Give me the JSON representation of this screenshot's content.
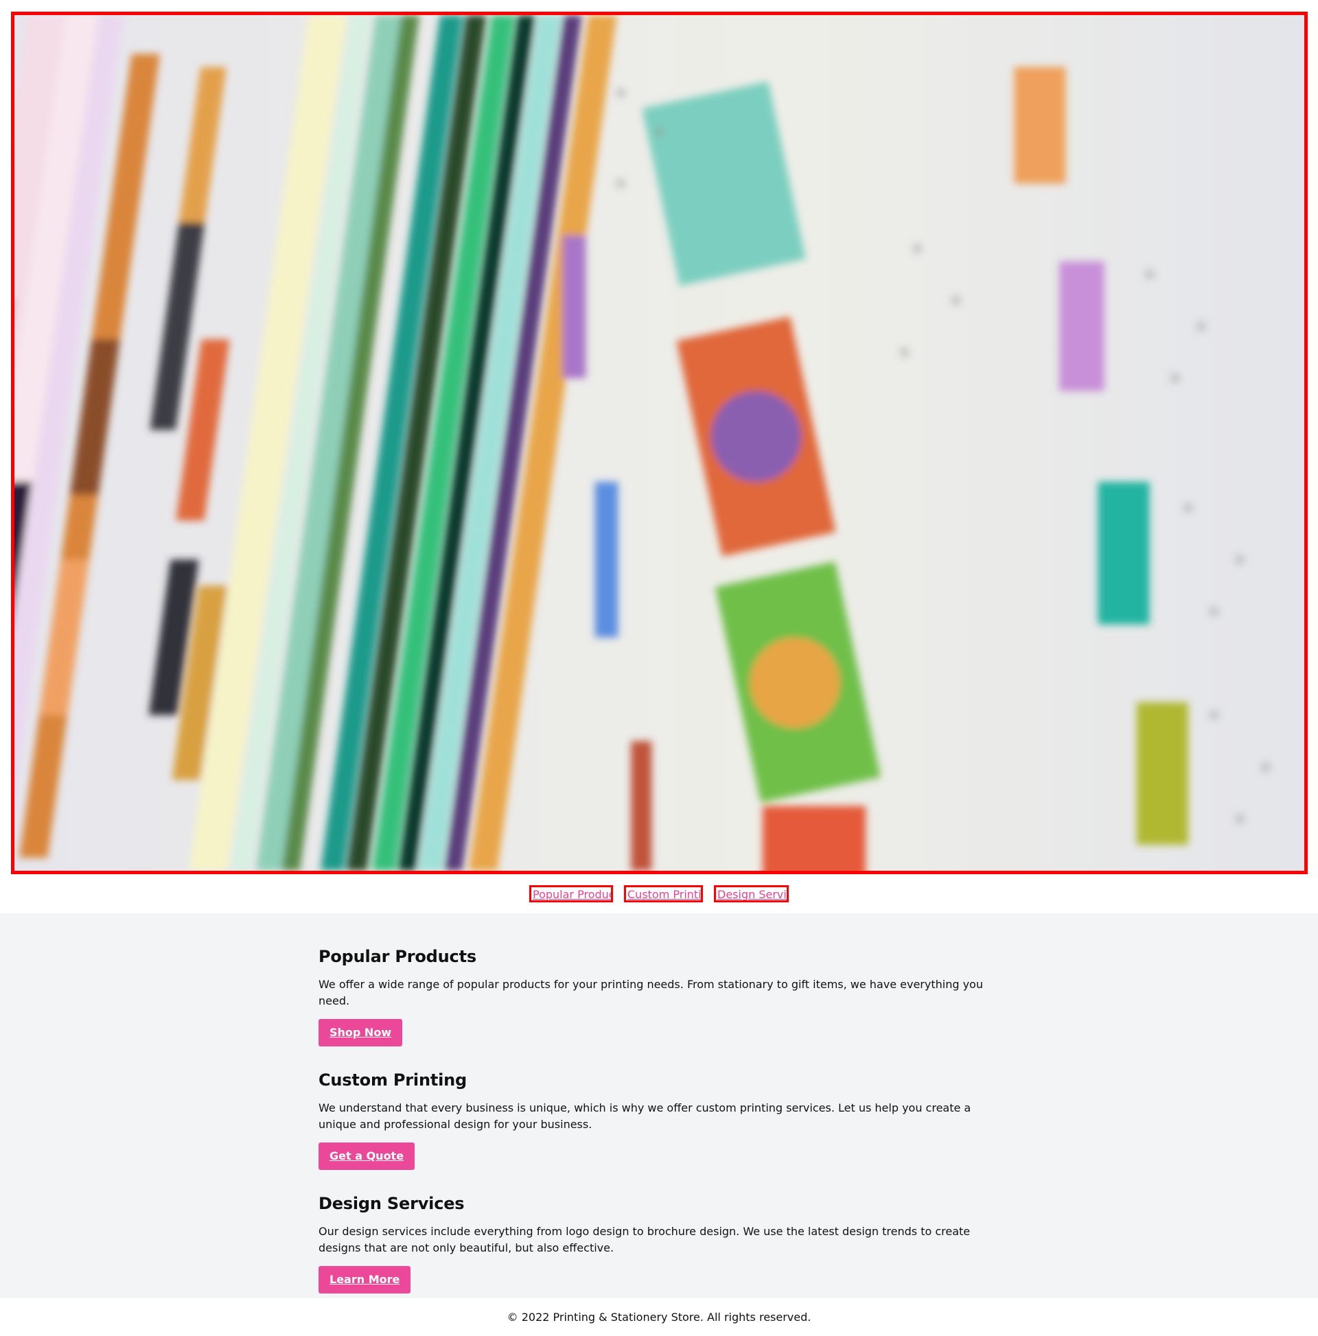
{
  "hero": {
    "image_name": "color swatch fan deck photo"
  },
  "links": [
    {
      "label": "Popular Products"
    },
    {
      "label": "Custom Printing"
    },
    {
      "label": "Design Services"
    }
  ],
  "sections": [
    {
      "title": "Popular Products",
      "text": "We offer a wide range of popular products for your printing needs. From stationary to gift items, we have everything you need.",
      "button": "Shop Now"
    },
    {
      "title": "Custom Printing",
      "text": "We understand that every business is unique, which is why we offer custom printing services. Let us help you create a unique and professional design for your business.",
      "button": "Get a Quote"
    },
    {
      "title": "Design Services",
      "text": "Our design services include everything from logo design to brochure design. We use the latest design trends to create designs that are not only beautiful, but also effective.",
      "button": "Learn More"
    }
  ],
  "footer": {
    "text": "© 2022 Printing & Stationery Store. All rights reserved."
  },
  "colors": {
    "accent": "#ec4899",
    "link": "#e84393",
    "highlight_border": "#ff0000",
    "section_bg": "#f3f4f6"
  }
}
